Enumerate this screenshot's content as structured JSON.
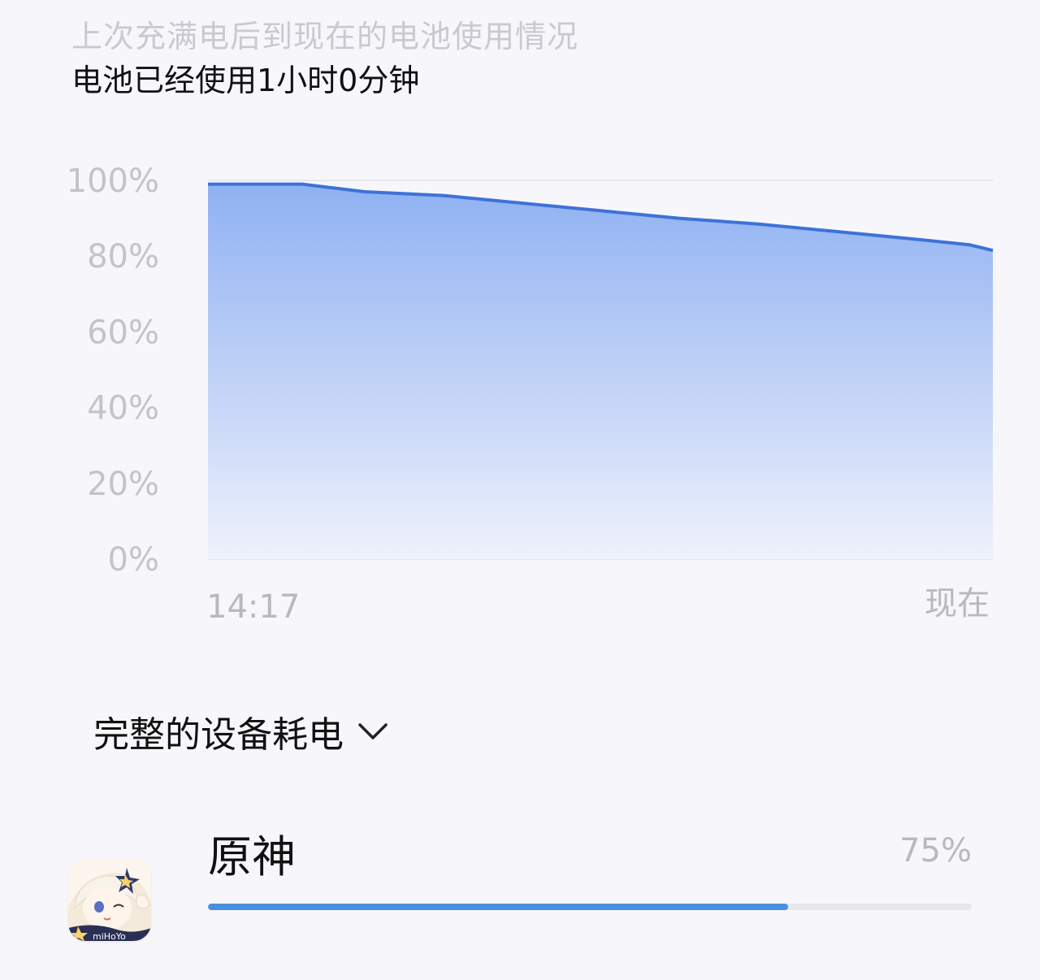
{
  "header": {
    "subtitle": "上次充满电后到现在的电池使用情况",
    "title": "电池已经使用1小时0分钟"
  },
  "chart_data": {
    "type": "area",
    "title": "",
    "xlabel": "",
    "ylabel": "",
    "x_tick_labels": [
      "14:17",
      "现在"
    ],
    "y_tick_labels": [
      "100%",
      "80%",
      "60%",
      "40%",
      "20%",
      "0%"
    ],
    "ylim": [
      0,
      100
    ],
    "grid": true,
    "x": [
      0,
      0.06,
      0.12,
      0.2,
      0.3,
      0.4,
      0.5,
      0.6,
      0.7,
      0.8,
      0.9,
      0.97,
      1.0
    ],
    "values": [
      99,
      99,
      99,
      97,
      96,
      94,
      92,
      90,
      88.5,
      86.5,
      84.5,
      83,
      81.5
    ],
    "colors": {
      "line": "#3d72d8",
      "fill_top": "#8fb1f2",
      "fill_bottom": "#eef1fb",
      "grid": "#e2e2e8"
    }
  },
  "section": {
    "label": "完整的设备耗电",
    "icon": "chevron-down-icon"
  },
  "apps": [
    {
      "name": "原神",
      "percent_label": "75%",
      "usage_fraction": 0.76,
      "icon": "genshin-app-icon",
      "icon_text": "miHoYo"
    }
  ]
}
